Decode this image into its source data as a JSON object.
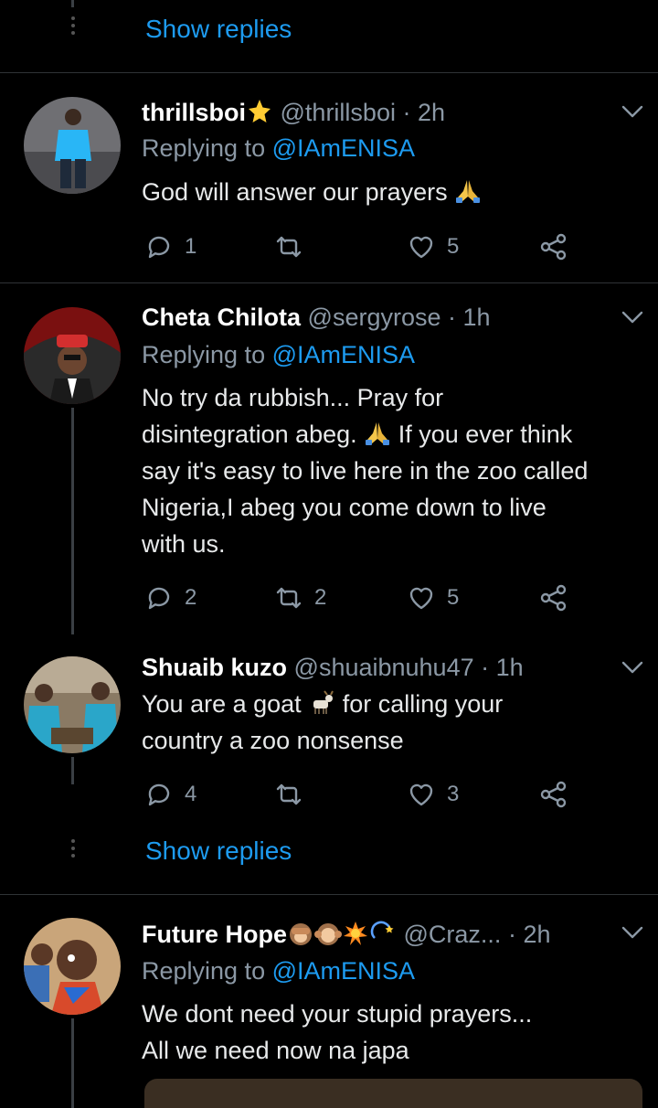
{
  "top_show_replies": "Show replies",
  "mid_show_replies": "Show replies",
  "tweets": [
    {
      "name": "thrillsboi",
      "handle": "@thrillsboi",
      "time": "· 2h",
      "replying_prefix": "Replying to ",
      "replying_to": "@IAmENISA",
      "text": [
        "God will answer our prayers"
      ],
      "counts": {
        "reply": "1",
        "retweet": "",
        "like": "5"
      }
    },
    {
      "name": "Cheta Chilota",
      "handle": "@sergyrose",
      "time": "· 1h",
      "replying_prefix": "Replying to ",
      "replying_to": "@IAmENISA",
      "text": [
        "No try da rubbish... Pray for",
        "disintegration abeg.",
        "If you ever think",
        "say it's easy to live here in the zoo called",
        "Nigeria,I abeg you come down to live",
        "with us."
      ],
      "counts": {
        "reply": "2",
        "retweet": "2",
        "like": "5"
      }
    },
    {
      "name": "Shuaib kuzo",
      "handle": "@shuaibnuhu47",
      "time": "· 1h",
      "text": [
        "You are a goat",
        "for calling your",
        "country a zoo nonsense"
      ],
      "counts": {
        "reply": "4",
        "retweet": "",
        "like": "3"
      }
    },
    {
      "name": "Future Hope",
      "handle": "@Craz...",
      "time": "· 2h",
      "replying_prefix": "Replying to ",
      "replying_to": "@IAmENISA",
      "text": [
        "We dont need your stupid prayers...",
        "All we need now na japa"
      ]
    }
  ],
  "icons": {
    "reply": "reply-icon",
    "retweet": "retweet-icon",
    "like": "heart-icon",
    "share": "share-icon",
    "more": "chevron-down-icon"
  },
  "colors": {
    "background": "#000000",
    "accent": "#1d9bf0",
    "muted": "#8b98a5",
    "divider": "#2f3336"
  }
}
